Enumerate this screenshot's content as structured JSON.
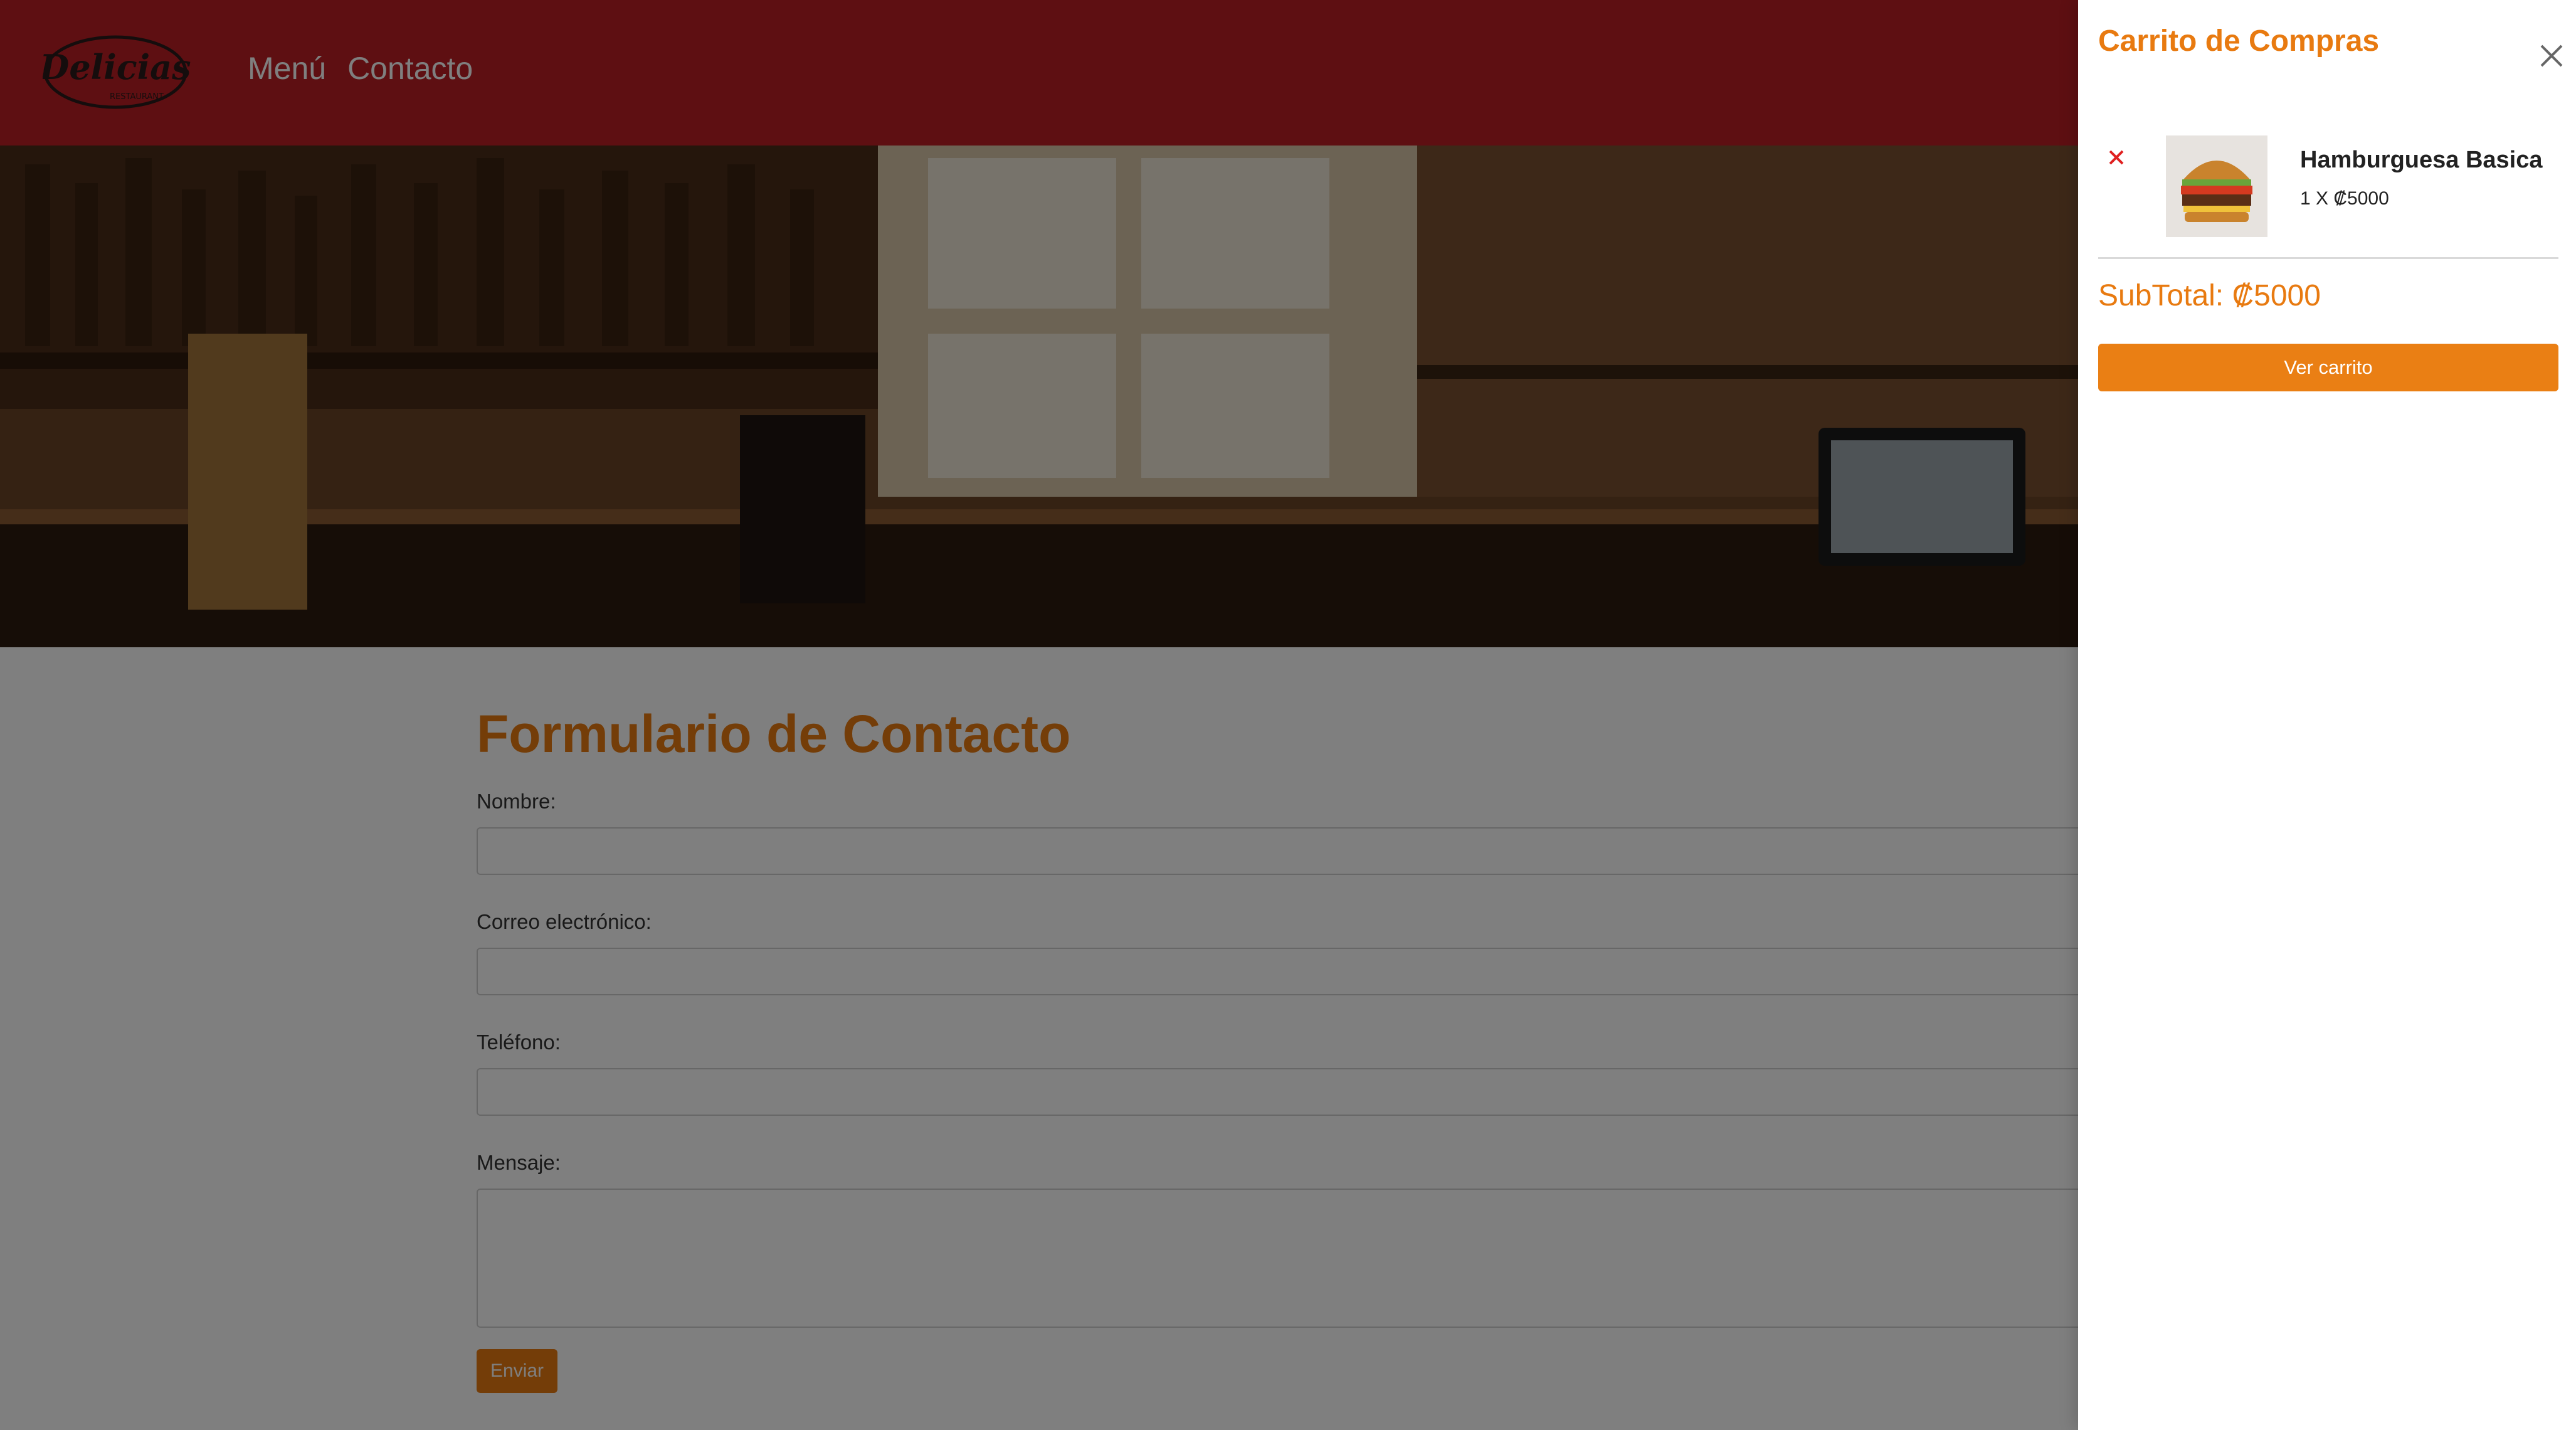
{
  "header": {
    "logo_text": "Delicias",
    "logo_subtext": "RESTAURANT",
    "nav": [
      {
        "label": "Menú"
      },
      {
        "label": "Contacto"
      }
    ]
  },
  "contact_form": {
    "title": "Formulario de Contacto",
    "fields": {
      "name_label": "Nombre:",
      "email_label": "Correo electrónico:",
      "phone_label": "Teléfono:",
      "message_label": "Mensaje:"
    },
    "submit_label": "Enviar"
  },
  "cart": {
    "title": "Carrito de Compras",
    "items": [
      {
        "name": "Hamburguesa Basica",
        "quantity_line": "1 X ₡5000"
      }
    ],
    "subtotal": "SubTotal: ₡5000",
    "view_cart_label": "Ver carrito"
  },
  "colors": {
    "header_bg": "#bd1f24",
    "accent": "#e87a10",
    "remove": "#e02020",
    "overlay": "rgba(0,0,0,0.5)"
  },
  "icons": {
    "close": "close-icon",
    "remove": "remove-icon"
  }
}
